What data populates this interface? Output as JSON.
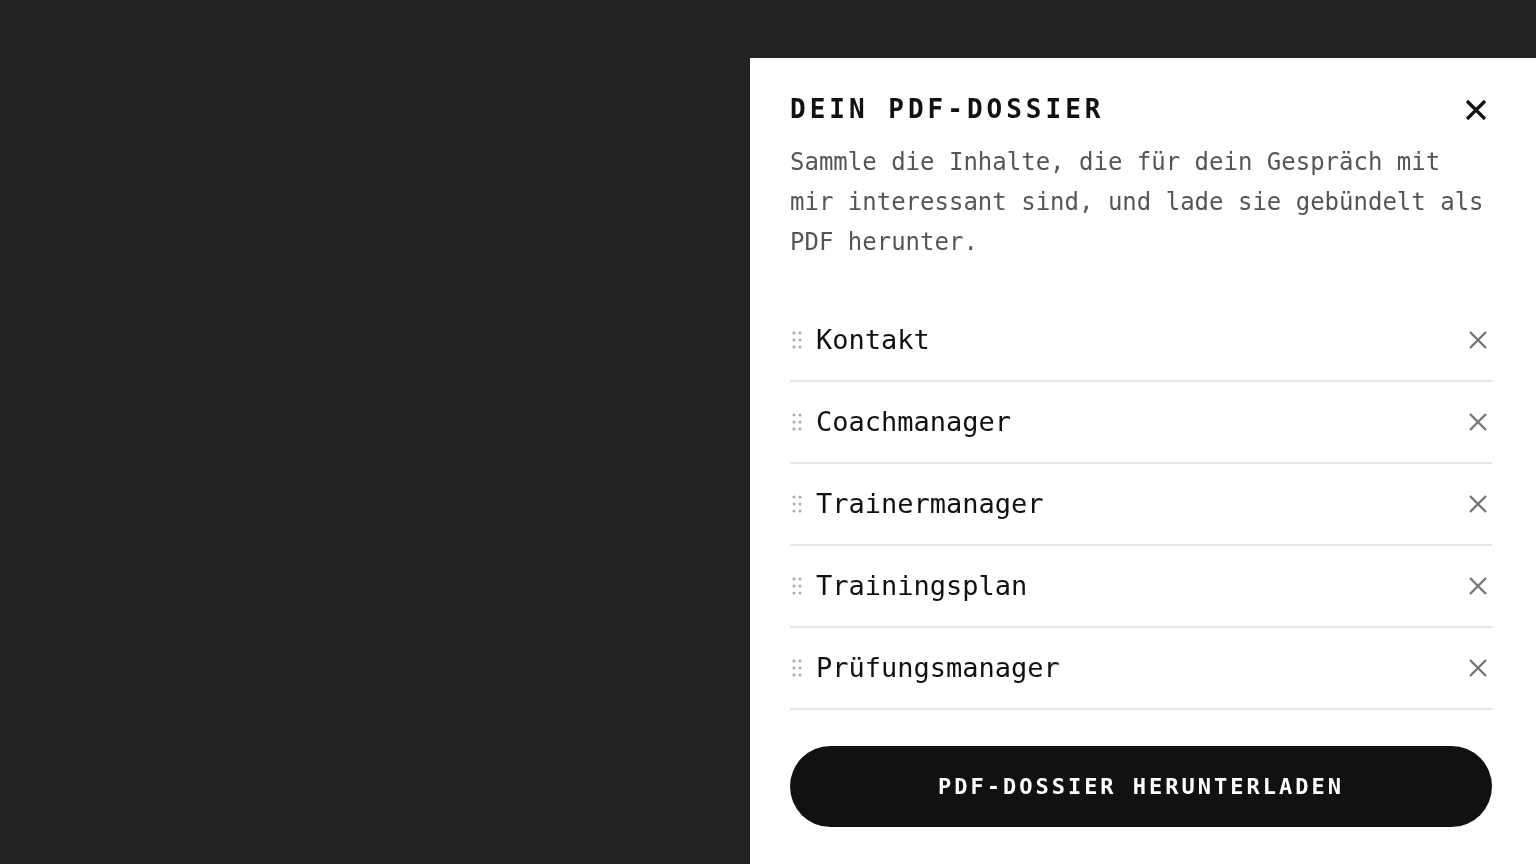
{
  "panel": {
    "title": "DEIN PDF-DOSSIER",
    "description": "Sammle die Inhalte, die für dein Gespräch mit mir interessant sind, und lade sie gebündelt als PDF herunter."
  },
  "items": [
    {
      "label": "Kontakt"
    },
    {
      "label": "Coachmanager"
    },
    {
      "label": "Trainermanager"
    },
    {
      "label": "Trainingsplan"
    },
    {
      "label": "Prüfungsmanager"
    }
  ],
  "download_button": {
    "label": "PDF-DOSSIER HERUNTERLADEN"
  }
}
